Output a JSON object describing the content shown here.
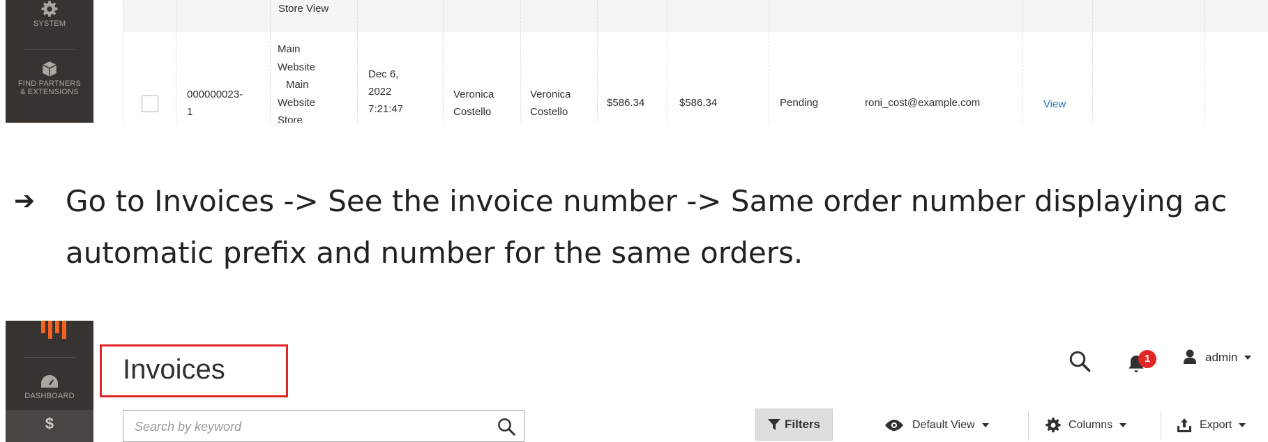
{
  "top_screenshot": {
    "sidebar": {
      "system_label": "SYSTEM",
      "partners_label_1": "FIND PARTNERS",
      "partners_label_2": "& EXTENSIONS"
    },
    "header_partial": "Store View",
    "row": {
      "id_1": "000000023-",
      "id_2": "1",
      "purchase_point": [
        "Main",
        "Website",
        "Main",
        "Website",
        "Store"
      ],
      "date": [
        "Dec 6,",
        "2022",
        "7:21:47"
      ],
      "bill_to": [
        "Veronica",
        "Costello"
      ],
      "ship_to": [
        "Veronica",
        "Costello"
      ],
      "grand_total_base": "$586.34",
      "grand_total_purchased": "$586.34",
      "status": "Pending",
      "email": "roni_cost@example.com",
      "action": "View"
    }
  },
  "caption": {
    "arrow": "➔",
    "line1": "Go to Invoices -> See the invoice number -> Same order number displaying ac",
    "line2": "automatic prefix and number for the same orders."
  },
  "bottom_screenshot": {
    "sidebar": {
      "dashboard_label": "DASHBOARD",
      "sales_icon_glyph": "$"
    },
    "page_title": "Invoices",
    "search": {
      "placeholder": "Search by keyword"
    },
    "toolbar": {
      "filters_label": "Filters",
      "view_label": "Default View",
      "columns_label": "Columns",
      "export_label": "Export"
    },
    "header": {
      "notification_count": "1",
      "admin_label": "admin"
    },
    "colors": {
      "highlight_border": "#e22626",
      "sidebar_bg": "#373330",
      "link": "#1979c3",
      "logo": "#f26322"
    }
  }
}
